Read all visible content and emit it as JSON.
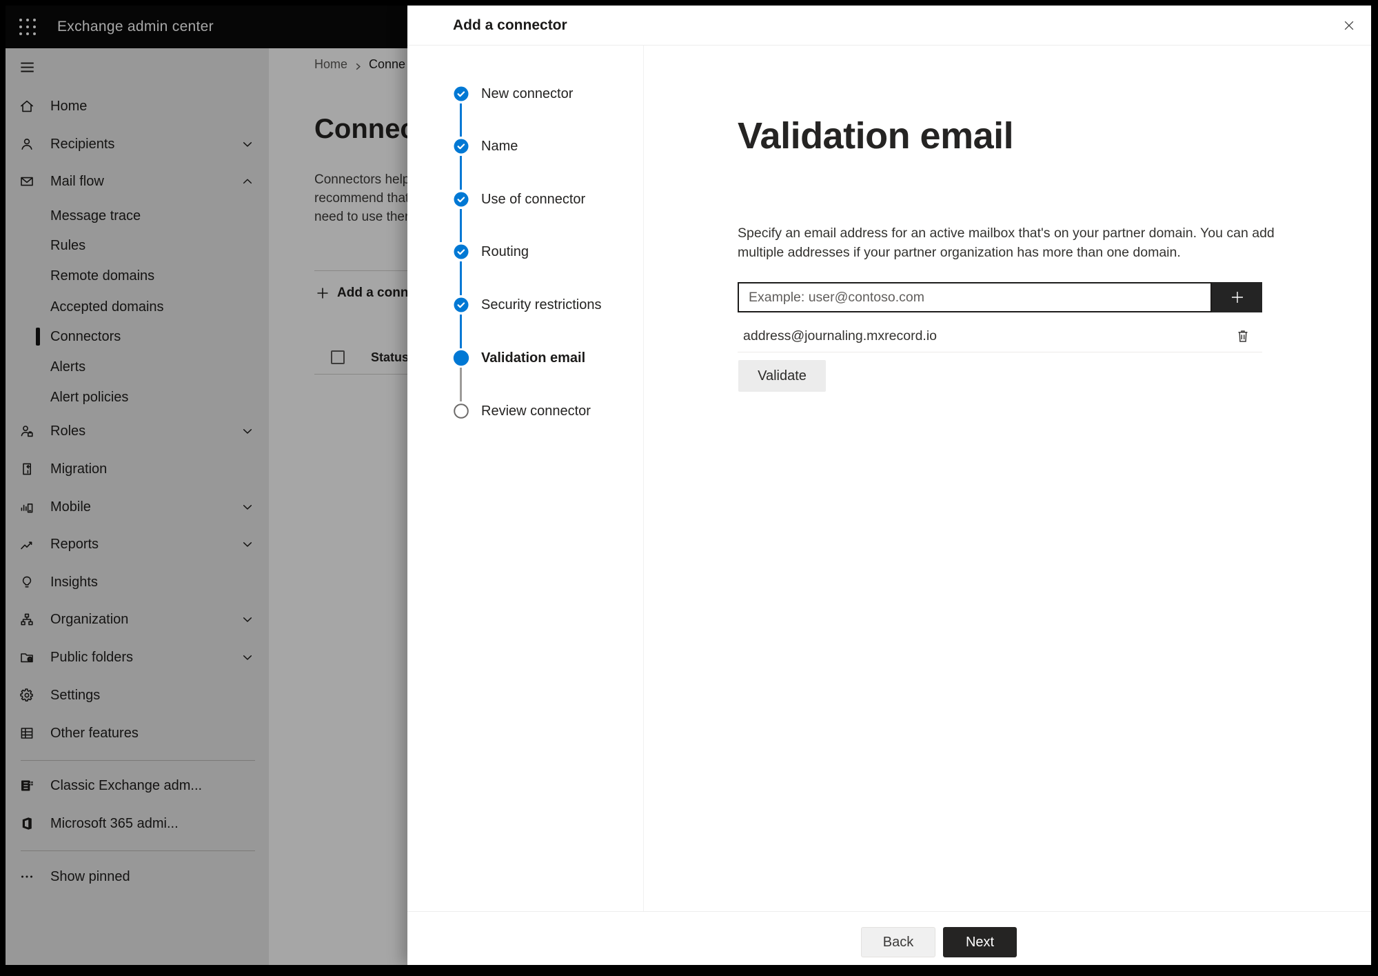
{
  "topbar": {
    "title": "Exchange admin center",
    "waffle_icon": "waffle-icon"
  },
  "sidebar": {
    "hamburger_icon": "hamburger-icon",
    "items": [
      {
        "label": "Home",
        "icon": "home-icon",
        "type": "top"
      },
      {
        "label": "Recipients",
        "icon": "recipients-icon",
        "type": "top",
        "chevron": "down"
      },
      {
        "label": "Mail flow",
        "icon": "mail-flow-icon",
        "type": "top",
        "chevron": "up"
      },
      {
        "label": "Message trace",
        "type": "sub"
      },
      {
        "label": "Rules",
        "type": "sub"
      },
      {
        "label": "Remote domains",
        "type": "sub"
      },
      {
        "label": "Accepted domains",
        "type": "sub"
      },
      {
        "label": "Connectors",
        "type": "sub",
        "selected": true
      },
      {
        "label": "Alerts",
        "type": "sub"
      },
      {
        "label": "Alert policies",
        "type": "sub"
      },
      {
        "label": "Roles",
        "icon": "roles-icon",
        "type": "top",
        "chevron": "down"
      },
      {
        "label": "Migration",
        "icon": "migration-icon",
        "type": "top"
      },
      {
        "label": "Mobile",
        "icon": "mobile-icon",
        "type": "top",
        "chevron": "down"
      },
      {
        "label": "Reports",
        "icon": "reports-icon",
        "type": "top",
        "chevron": "down"
      },
      {
        "label": "Insights",
        "icon": "insights-icon",
        "type": "top"
      },
      {
        "label": "Organization",
        "icon": "organization-icon",
        "type": "top",
        "chevron": "down"
      },
      {
        "label": "Public folders",
        "icon": "public-folders-icon",
        "type": "top",
        "chevron": "down"
      },
      {
        "label": "Settings",
        "icon": "settings-icon",
        "type": "top"
      },
      {
        "label": "Other features",
        "icon": "other-features-icon",
        "type": "top"
      },
      {
        "type": "divider"
      },
      {
        "label": "Classic Exchange adm...",
        "icon": "classic-exchange-icon",
        "type": "top"
      },
      {
        "label": "Microsoft 365 admi...",
        "icon": "microsoft-365-icon",
        "type": "top"
      },
      {
        "type": "divider"
      },
      {
        "label": "Show pinned",
        "icon": "show-pinned-icon",
        "type": "top"
      }
    ]
  },
  "page": {
    "breadcrumb": {
      "home": "Home",
      "current": "Conne"
    },
    "heading": "Connec",
    "description_lines": [
      "Connectors help",
      "recommend that",
      "need to use ther"
    ],
    "add_button_label": "Add a conn",
    "table": {
      "status_header": "Status"
    }
  },
  "dialog": {
    "title": "Add a connector",
    "close_icon": "close-icon",
    "steps": [
      {
        "label": "New connector",
        "state": "done"
      },
      {
        "label": "Name",
        "state": "done"
      },
      {
        "label": "Use of connector",
        "state": "done"
      },
      {
        "label": "Routing",
        "state": "done"
      },
      {
        "label": "Security restrictions",
        "state": "done"
      },
      {
        "label": "Validation email",
        "state": "current"
      },
      {
        "label": "Review connector",
        "state": "pending"
      }
    ],
    "main": {
      "heading": "Validation email",
      "description_line1": "Specify an email address for an active mailbox that's on your partner domain. You can add",
      "description_line2": "multiple addresses if your partner organization has more than one domain.",
      "email_input_value": "",
      "email_input_placeholder": "Example: user@contoso.com",
      "added_addresses": [
        "address@journaling.mxrecord.io"
      ],
      "validate_button_label": "Validate"
    },
    "footer": {
      "back_label": "Back",
      "next_label": "Next"
    }
  },
  "colors": {
    "accent_blue": "#0078d4",
    "dark_button": "#242424",
    "step_pending_gray": "#6b6968"
  }
}
